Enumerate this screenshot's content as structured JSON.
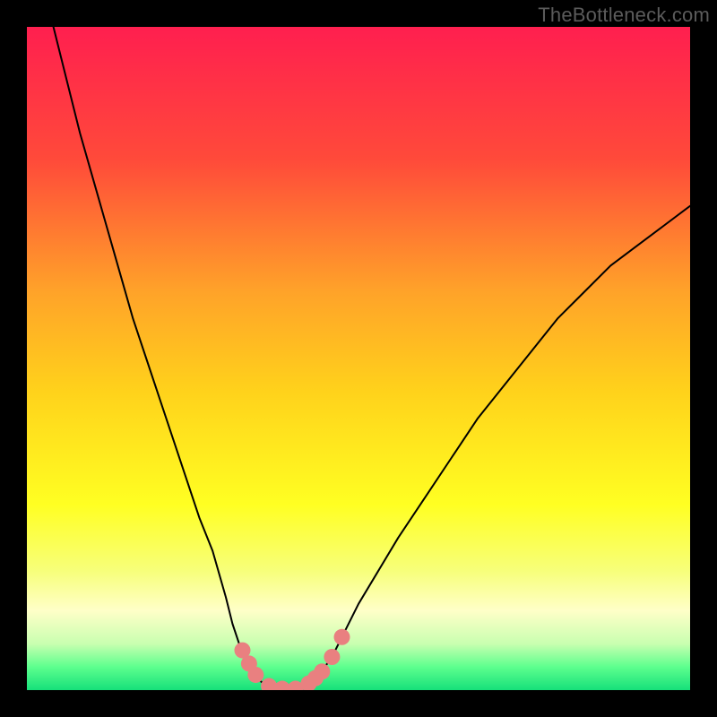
{
  "watermark": "TheBottleneck.com",
  "chart_data": {
    "type": "line",
    "title": "",
    "xlabel": "",
    "ylabel": "",
    "xlim": [
      0,
      100
    ],
    "ylim": [
      0,
      100
    ],
    "grid": false,
    "legend": false,
    "background_gradient_stops": [
      {
        "offset": 0.0,
        "color": "#ff1f4f"
      },
      {
        "offset": 0.2,
        "color": "#ff4a3a"
      },
      {
        "offset": 0.4,
        "color": "#ffa329"
      },
      {
        "offset": 0.55,
        "color": "#ffd21b"
      },
      {
        "offset": 0.72,
        "color": "#ffff22"
      },
      {
        "offset": 0.82,
        "color": "#f7ff7a"
      },
      {
        "offset": 0.88,
        "color": "#ffffc8"
      },
      {
        "offset": 0.93,
        "color": "#c9ffb0"
      },
      {
        "offset": 0.965,
        "color": "#5dff8e"
      },
      {
        "offset": 1.0,
        "color": "#16e07a"
      }
    ],
    "series": [
      {
        "name": "left-curve",
        "x": [
          4,
          6,
          8,
          10,
          12,
          14,
          16,
          18,
          20,
          22,
          24,
          26,
          28,
          30,
          31,
          32,
          33,
          34,
          35,
          36
        ],
        "values": [
          100,
          92,
          84,
          77,
          70,
          63,
          56,
          50,
          44,
          38,
          32,
          26,
          21,
          14,
          10,
          7,
          4.5,
          2.8,
          1.5,
          0.8
        ]
      },
      {
        "name": "bottom-curve",
        "x": [
          36,
          37,
          38,
          39,
          40,
          41,
          42,
          43,
          44
        ],
        "values": [
          0.8,
          0.4,
          0.2,
          0.1,
          0.1,
          0.25,
          0.6,
          1.2,
          2.2
        ]
      },
      {
        "name": "right-curve",
        "x": [
          44,
          46,
          48,
          50,
          53,
          56,
          60,
          64,
          68,
          72,
          76,
          80,
          84,
          88,
          92,
          96,
          100
        ],
        "values": [
          2.2,
          5,
          9,
          13,
          18,
          23,
          29,
          35,
          41,
          46,
          51,
          56,
          60,
          64,
          67,
          70,
          73
        ]
      }
    ],
    "markers": {
      "name": "highlighted-range",
      "color": "#e98080",
      "radius_px": 9,
      "points": [
        {
          "x": 32.5,
          "y": 6.0
        },
        {
          "x": 33.5,
          "y": 4.0
        },
        {
          "x": 34.5,
          "y": 2.3
        },
        {
          "x": 36.5,
          "y": 0.6
        },
        {
          "x": 38.5,
          "y": 0.2
        },
        {
          "x": 40.5,
          "y": 0.2
        },
        {
          "x": 42.5,
          "y": 1.0
        },
        {
          "x": 43.5,
          "y": 1.8
        },
        {
          "x": 44.5,
          "y": 2.8
        },
        {
          "x": 46.0,
          "y": 5.0
        },
        {
          "x": 47.5,
          "y": 8.0
        }
      ]
    }
  }
}
